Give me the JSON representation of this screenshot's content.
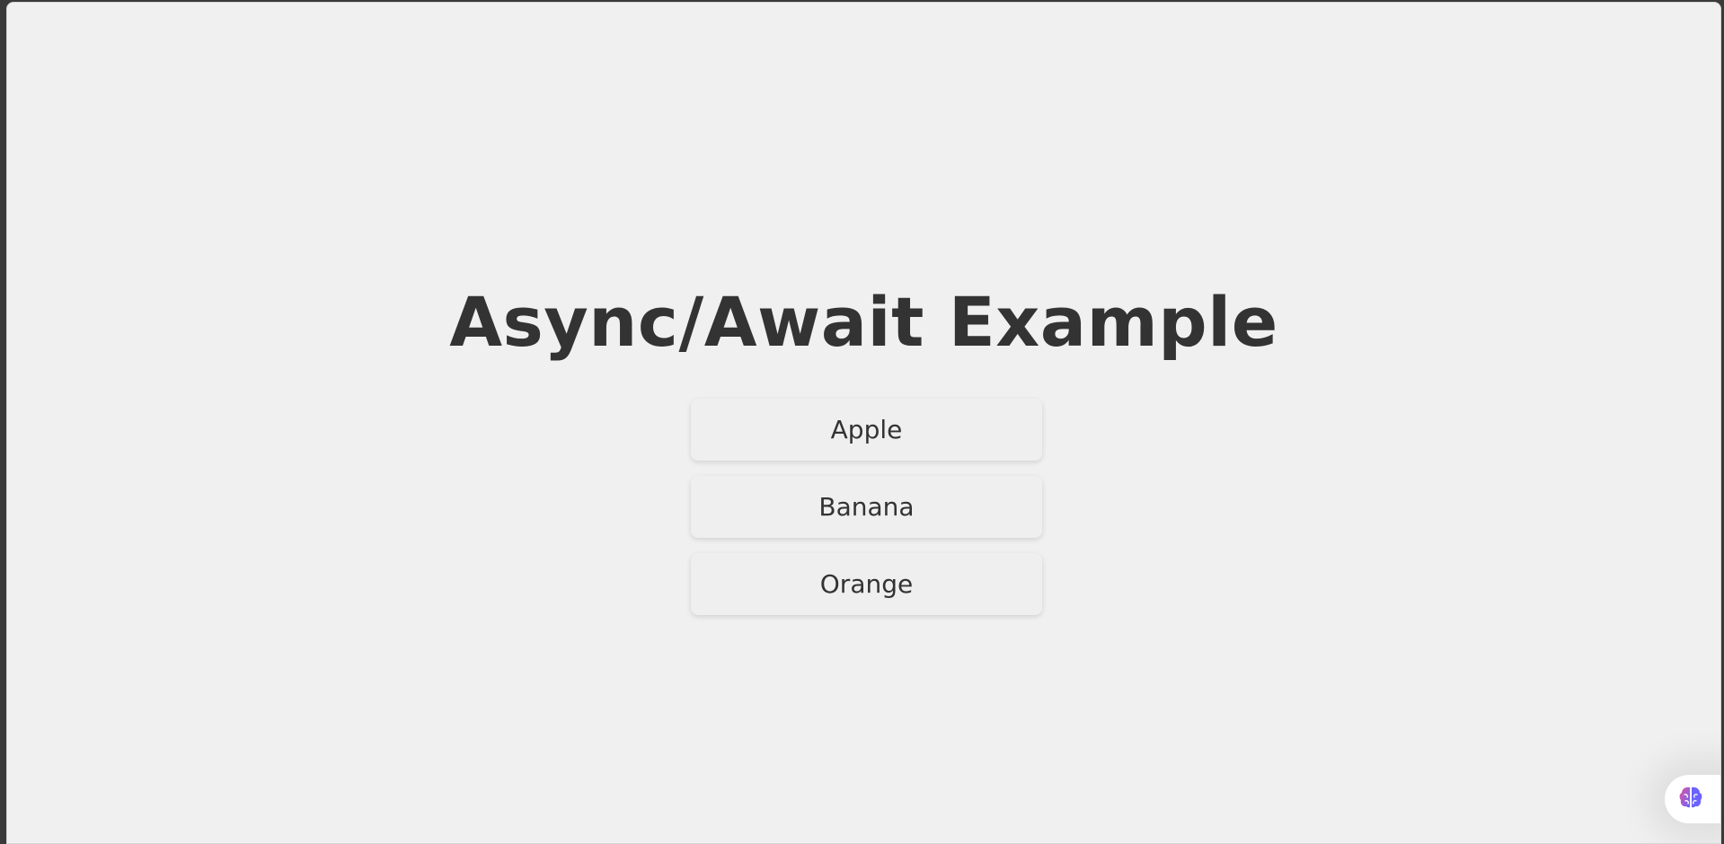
{
  "page": {
    "title": "Async/Await Example"
  },
  "fruits": [
    {
      "label": "Apple"
    },
    {
      "label": "Banana"
    },
    {
      "label": "Orange"
    }
  ],
  "widget": {
    "icon": "brain-icon",
    "colors": {
      "left": "#e0559c",
      "right": "#6c63ff"
    }
  }
}
